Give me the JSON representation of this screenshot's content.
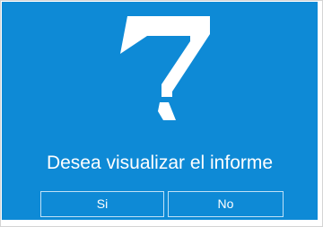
{
  "dialog": {
    "icon": "question-mark-icon",
    "message": "Desea visualizar el informe",
    "buttons": {
      "yes_label": "Si",
      "no_label": "No"
    },
    "colors": {
      "background": "#0e8ad6",
      "text": "#ffffff",
      "button_border": "#bfe1f7"
    }
  }
}
